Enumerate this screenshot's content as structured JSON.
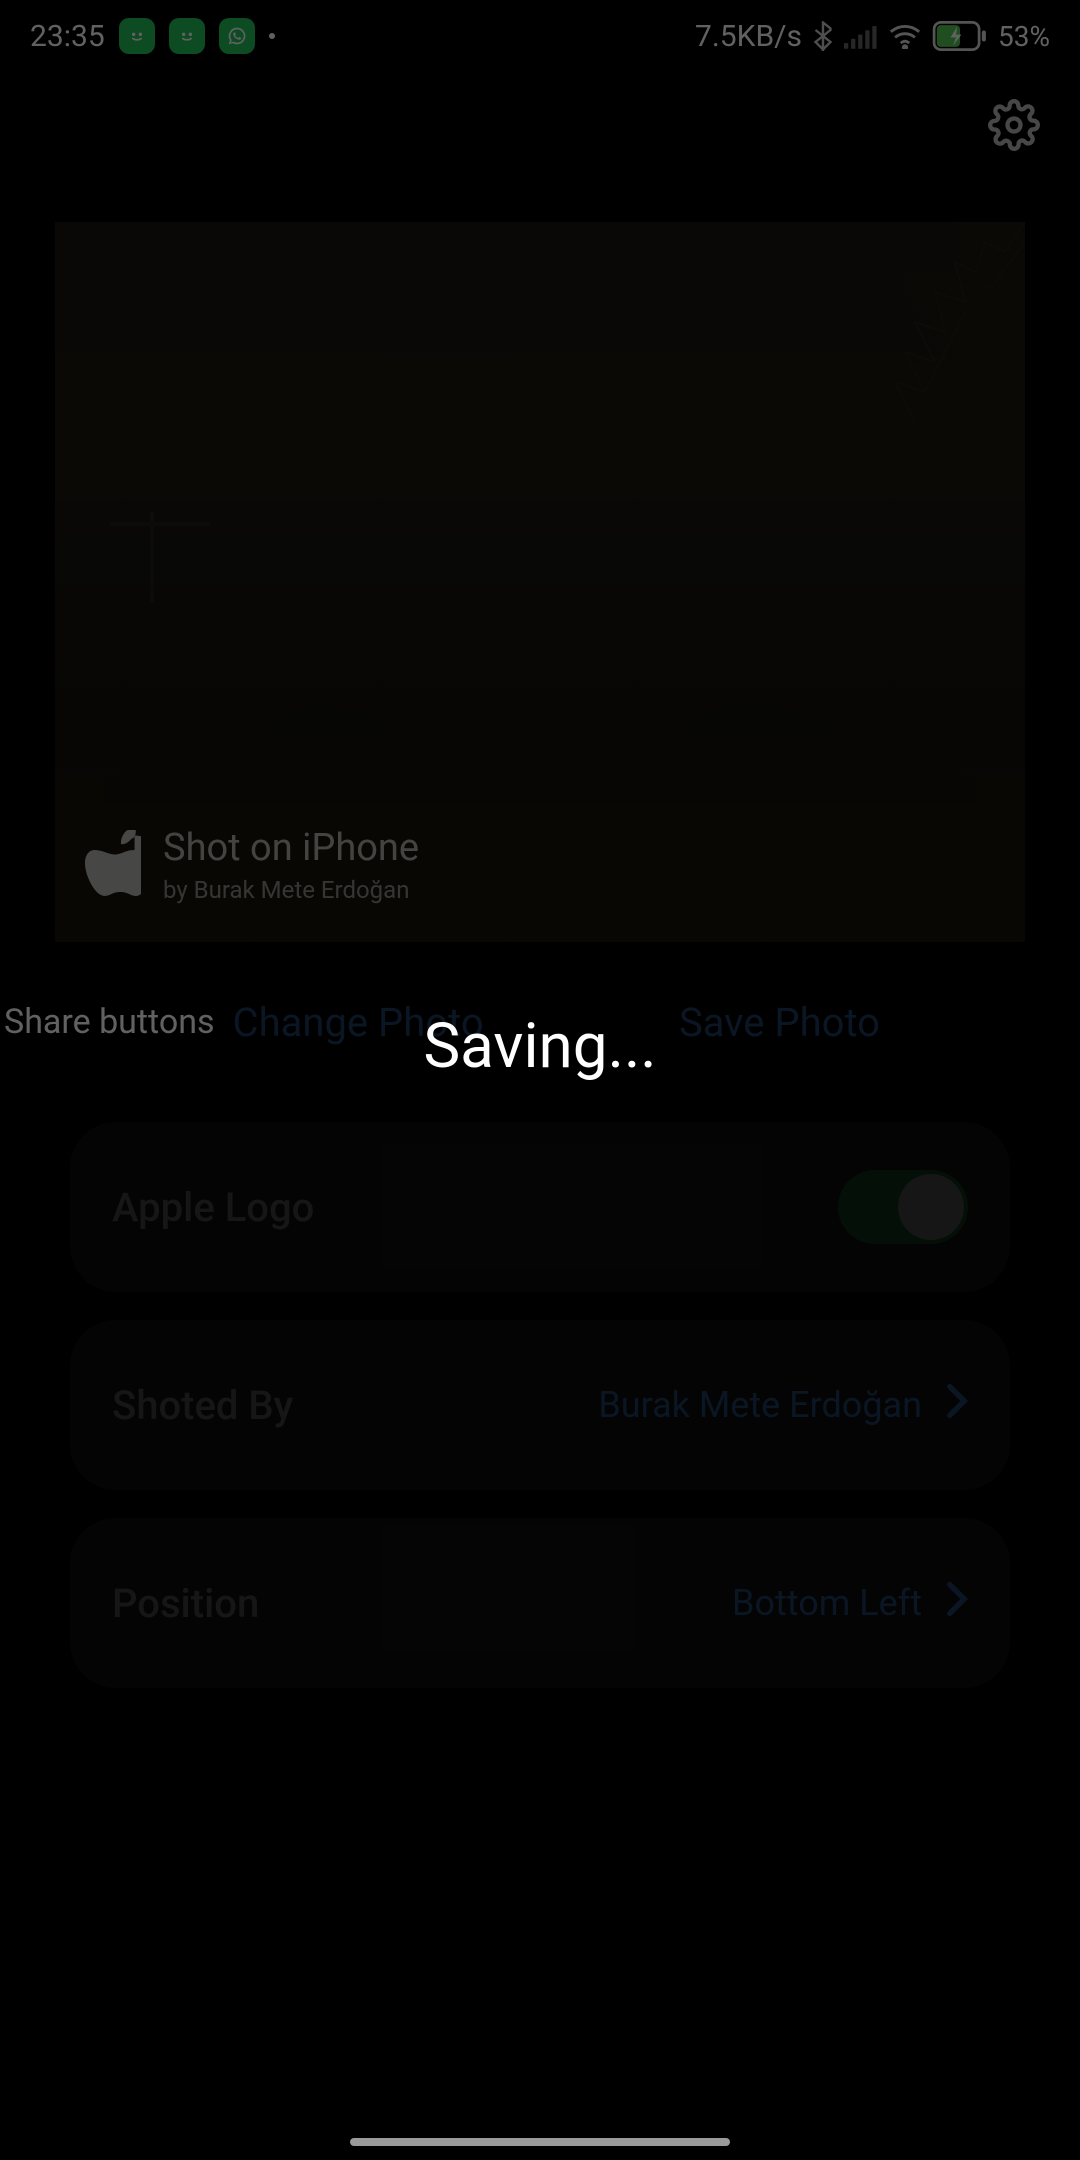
{
  "status": {
    "time": "23:35",
    "net_speed": "7.5KB/s",
    "battery": "53%"
  },
  "watermark": {
    "title": "Shot on iPhone",
    "subtitle": "by Burak Mete Erdoğan"
  },
  "overlay": {
    "saving": "Saving..."
  },
  "actions": {
    "share": "Share buttons",
    "change": "Change Photo",
    "save": "Save Photo"
  },
  "settings": {
    "apple_logo_label": "Apple Logo",
    "shoted_by_label": "Shoted By",
    "shoted_by_value": "Burak Mete Erdoğan",
    "position_label": "Position",
    "position_value": "Bottom Left"
  }
}
